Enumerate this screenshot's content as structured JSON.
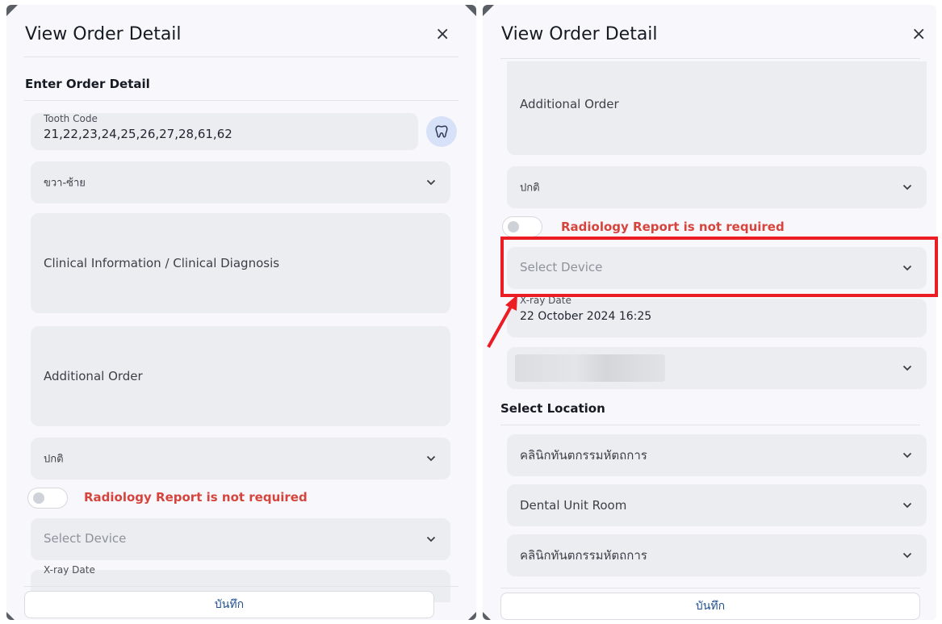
{
  "left": {
    "title": "View Order Detail",
    "close": "×",
    "section": "Enter Order Detail",
    "tooth_code": {
      "label": "Tooth Code",
      "value": "21,22,23,24,25,26,27,28,61,62"
    },
    "side_select": "ขวา-ซ้าย",
    "clinical": "Clinical Information / Clinical Diagnosis",
    "additional": "Additional Order",
    "priority": "ปกติ",
    "radiology": "Radiology Report is not required",
    "device_placeholder": "Select Device",
    "xray_label": "X-ray Date",
    "save": "บันทึก"
  },
  "right": {
    "title": "View Order Detail",
    "close": "×",
    "additional": "Additional Order",
    "priority": "ปกติ",
    "radiology": "Radiology Report is not required",
    "device_placeholder": "Select Device",
    "xray": {
      "label": "X-ray Date",
      "value": "22 October 2024 16:25"
    },
    "section_location": "Select Location",
    "locations": [
      "คลินิกทันตกรรมหัตถการ",
      "Dental Unit Room",
      "คลินิกทันตกรรมหัตถการ"
    ],
    "save": "บันทึก"
  },
  "colors": {
    "warning": "#d6453d",
    "highlight": "#ec1c24",
    "tooth_button": "#d7e1f7"
  }
}
